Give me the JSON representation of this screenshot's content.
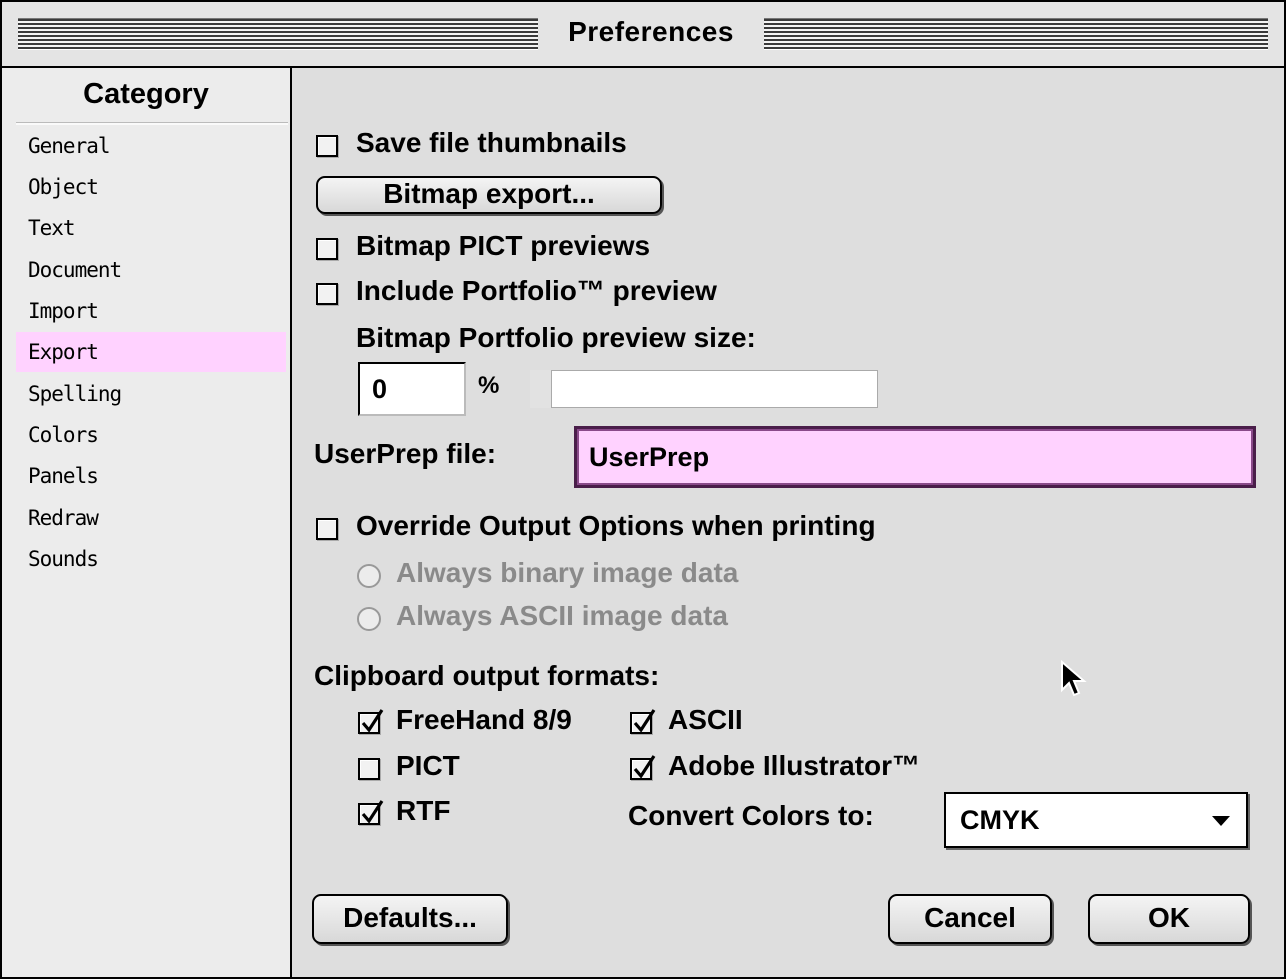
{
  "window": {
    "title": "Preferences"
  },
  "sidebar": {
    "header": "Category",
    "items": [
      {
        "label": "General"
      },
      {
        "label": "Object"
      },
      {
        "label": "Text"
      },
      {
        "label": "Document"
      },
      {
        "label": "Import"
      },
      {
        "label": "Export",
        "selected": true
      },
      {
        "label": "Spelling"
      },
      {
        "label": "Colors"
      },
      {
        "label": "Panels"
      },
      {
        "label": "Redraw"
      },
      {
        "label": "Sounds"
      }
    ]
  },
  "export": {
    "save_thumbnails": {
      "label": "Save file thumbnails",
      "checked": false
    },
    "bitmap_export_button": "Bitmap export...",
    "bitmap_pict_previews": {
      "label": "Bitmap PICT previews",
      "checked": false
    },
    "include_portfolio": {
      "label": "Include Portfolio™ preview",
      "checked": false
    },
    "portfolio_size_label": "Bitmap Portfolio preview size:",
    "portfolio_size_value": "0",
    "portfolio_size_unit": "%",
    "portfolio_size_fraction": 0,
    "userprep_label": "UserPrep file:",
    "userprep_value": "UserPrep",
    "override_output": {
      "label": "Override Output Options when printing",
      "checked": false
    },
    "radio_binary": {
      "label": "Always binary image data",
      "enabled": false
    },
    "radio_ascii": {
      "label": "Always ASCII image data",
      "enabled": false
    },
    "clipboard_label": "Clipboard output formats:",
    "fmt_freehand": {
      "label": "FreeHand 8/9",
      "checked": true
    },
    "fmt_pict": {
      "label": "PICT",
      "checked": false
    },
    "fmt_rtf": {
      "label": "RTF",
      "checked": true
    },
    "fmt_ascii": {
      "label": "ASCII",
      "checked": true
    },
    "fmt_illustrator": {
      "label": "Adobe Illustrator™",
      "checked": true
    },
    "convert_colors_label": "Convert Colors to:",
    "convert_colors_value": "CMYK"
  },
  "buttons": {
    "defaults": "Defaults...",
    "cancel": "Cancel",
    "ok": "OK"
  },
  "colors": {
    "selection": "#ffd2ff",
    "focus_border": "#4a1e4a",
    "window_bg": "#dedede"
  }
}
